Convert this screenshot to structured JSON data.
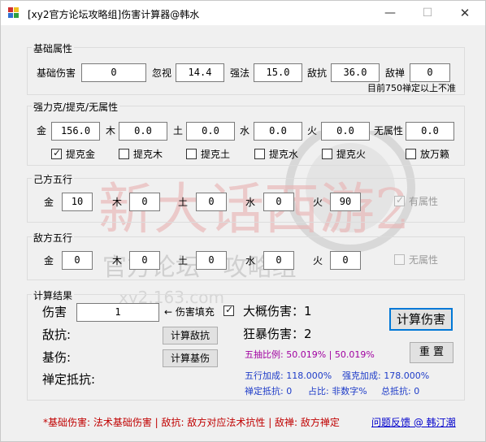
{
  "window": {
    "title": "[xy2官方论坛攻略组]伤害计算器@韩水",
    "minimize": "—",
    "maximize": "☐",
    "close": "✕"
  },
  "watermark": {
    "line1": "新大话西游2",
    "line2": "官方论坛 · 攻略组",
    "line3": "xy2.163.com"
  },
  "basic": {
    "title": "基础属性",
    "base_damage_label": "基础伤害",
    "base_damage": "0",
    "ignore_label": "忽视",
    "ignore": "14.4",
    "strong_label": "强法",
    "strong": "15.0",
    "enemy_resist_label": "敌抗",
    "enemy_resist": "36.0",
    "enemy_zen_label": "敌禅",
    "enemy_zen": "0",
    "note": "目前750禅定以上不准"
  },
  "strong_group": {
    "title": "强力克/提克/无属性",
    "metal_label": "金",
    "metal": "156.0",
    "wood_label": "木",
    "wood": "0.0",
    "earth_label": "土",
    "earth": "0.0",
    "water_label": "水",
    "water": "0.0",
    "fire_label": "火",
    "fire": "0.0",
    "none_label": "无属性",
    "none": "0.0",
    "checks": [
      {
        "label": "提克金",
        "checked": true
      },
      {
        "label": "提克木",
        "checked": false
      },
      {
        "label": "提克土",
        "checked": false
      },
      {
        "label": "提克水",
        "checked": false
      },
      {
        "label": "提克火",
        "checked": false
      },
      {
        "label": "放万籁",
        "checked": false
      }
    ]
  },
  "own_elements": {
    "title": "己方五行",
    "metal_label": "金",
    "metal": "10",
    "wood_label": "木",
    "wood": "0",
    "earth_label": "土",
    "earth": "0",
    "water_label": "水",
    "water": "0",
    "fire_label": "火",
    "fire": "90",
    "attr_label": "有属性",
    "attr_checked": true
  },
  "enemy_elements": {
    "title": "敌方五行",
    "metal_label": "金",
    "metal": "0",
    "wood_label": "木",
    "wood": "0",
    "earth_label": "土",
    "earth": "0",
    "water_label": "水",
    "water": "0",
    "fire_label": "火",
    "fire": "0",
    "attr_label": "无属性",
    "attr_checked": false
  },
  "result": {
    "title": "计算结果",
    "damage_label": "伤害",
    "damage_value": "1",
    "fill_hint": "← 伤害填充",
    "approx_label": "大概伤害：",
    "approx_value": "1",
    "enemy_resist_label": "敌抗:",
    "calc_resist_button": "计算敌抗",
    "rage_label": "狂暴伤害：",
    "rage_value": "2",
    "base_label": "基伤:",
    "calc_base_button": "计算基伤",
    "zen_label": "禅定抵抗:",
    "calc_damage_button": "计算伤害",
    "reset_button": "重 置",
    "ratio_text": "五抽比例: 50.019% | 50.019%",
    "element_bonus": "五行加成: 118.000%",
    "strong_bonus": "强克加成: 178.000%",
    "zen_resist": "禅定抵抗: 0",
    "share": "占比: 非数字%",
    "total_resist": "总抵抗: 0"
  },
  "footer": {
    "legend": "*基础伤害: 法术基础伤害 | 敌抗: 敌方对应法术抗性 | 敌禅: 敌方禅定",
    "feedback_link": "问题反馈 @ 韩汀潮"
  },
  "colors": {
    "accent": "#0078d7",
    "purple": "#a000a0",
    "blue": "#1e3cc8",
    "footer_red": "#c00000"
  }
}
